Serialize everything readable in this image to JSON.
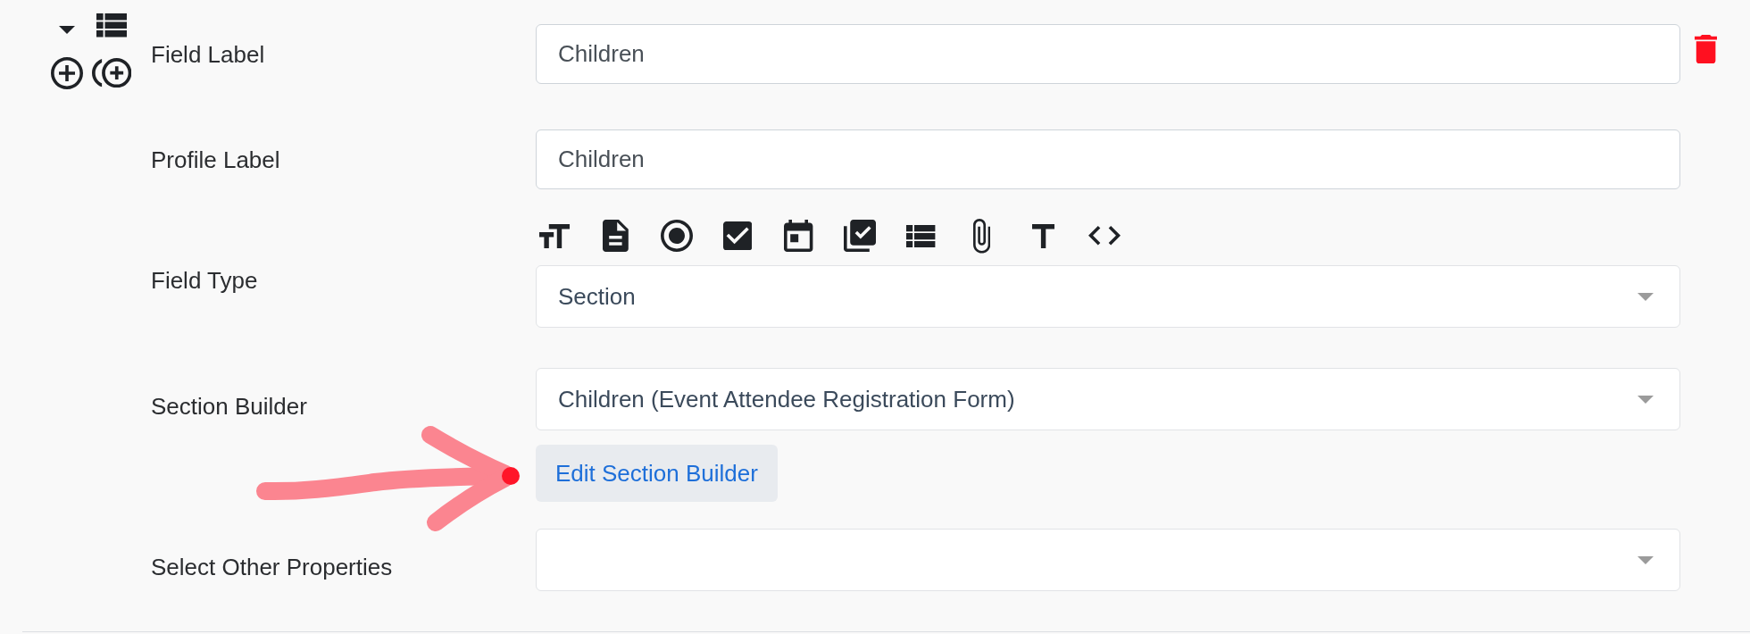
{
  "field": {
    "expanded": true,
    "rows": [
      {
        "kind": "text",
        "label": "Field Label",
        "value": "Children"
      },
      {
        "kind": "text",
        "label": "Profile Label",
        "value": "Children"
      },
      {
        "kind": "type_select",
        "label": "Field Type",
        "value": "Section"
      },
      {
        "kind": "select",
        "label": "Section Builder",
        "value": "Children (Event Attendee Registration Form)",
        "button": "Edit Section Builder"
      },
      {
        "kind": "select",
        "label": "Select Other Properties"
      }
    ]
  }
}
